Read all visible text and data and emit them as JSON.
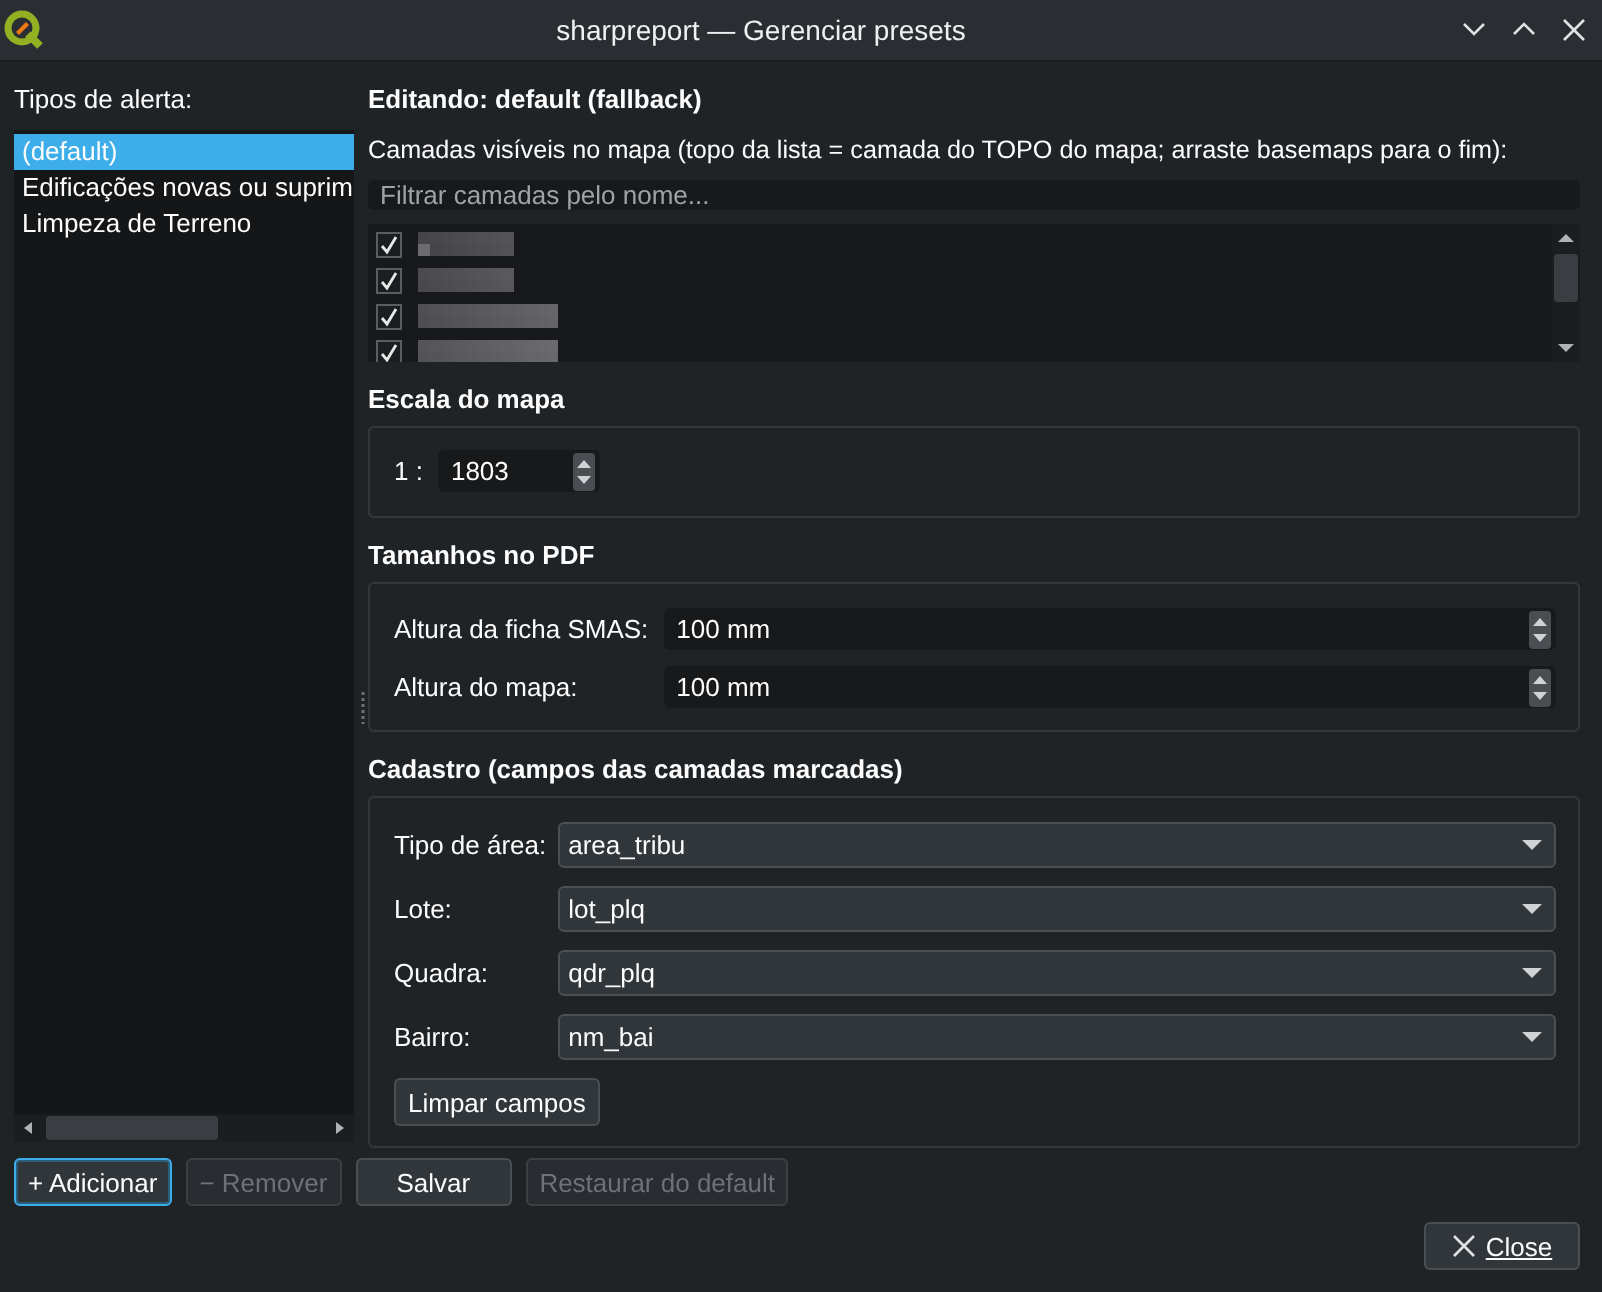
{
  "window": {
    "title": "sharpreport — Gerenciar presets"
  },
  "alert_types": {
    "label": "Tipos de alerta:",
    "items": [
      {
        "label": "(default)",
        "selected": true
      },
      {
        "label": "Edificações novas ou suprim",
        "selected": false
      },
      {
        "label": "Limpeza de Terreno",
        "selected": false
      }
    ]
  },
  "editor": {
    "heading": "Editando: default (fallback)",
    "layers_label": "Camadas visíveis no mapa (topo da lista = camada do TOPO do mapa; arraste basemaps para o fim):",
    "filter": {
      "placeholder": "Filtrar camadas pelo nome..."
    },
    "layers": [
      {
        "checked": true
      },
      {
        "checked": true
      },
      {
        "checked": true
      },
      {
        "checked": true
      }
    ]
  },
  "scale": {
    "title": "Escala do mapa",
    "prefix": "1 :",
    "value": "1803"
  },
  "pdf_sizes": {
    "title": "Tamanhos no PDF",
    "fields": [
      {
        "label": "Altura da ficha SMAS:",
        "value": "100 mm"
      },
      {
        "label": "Altura do mapa:",
        "value": "100 mm"
      }
    ]
  },
  "cadastre": {
    "title": "Cadastro (campos das camadas marcadas)",
    "fields": [
      {
        "label": "Tipo de área:",
        "value": "area_tribu"
      },
      {
        "label": "Lote:",
        "value": "lot_plq"
      },
      {
        "label": "Quadra:",
        "value": "qdr_plq"
      },
      {
        "label": "Bairro:",
        "value": "nm_bai"
      }
    ],
    "clear_button": "Limpar campos"
  },
  "actions": [
    {
      "label": "+ Adicionar",
      "disabled": false,
      "focused": true
    },
    {
      "label": "− Remover",
      "disabled": true,
      "focused": false
    },
    {
      "label": "Salvar",
      "disabled": false,
      "focused": false
    },
    {
      "label": "Restaurar do default",
      "disabled": true,
      "focused": false
    }
  ],
  "close_button": {
    "label": "Close"
  }
}
